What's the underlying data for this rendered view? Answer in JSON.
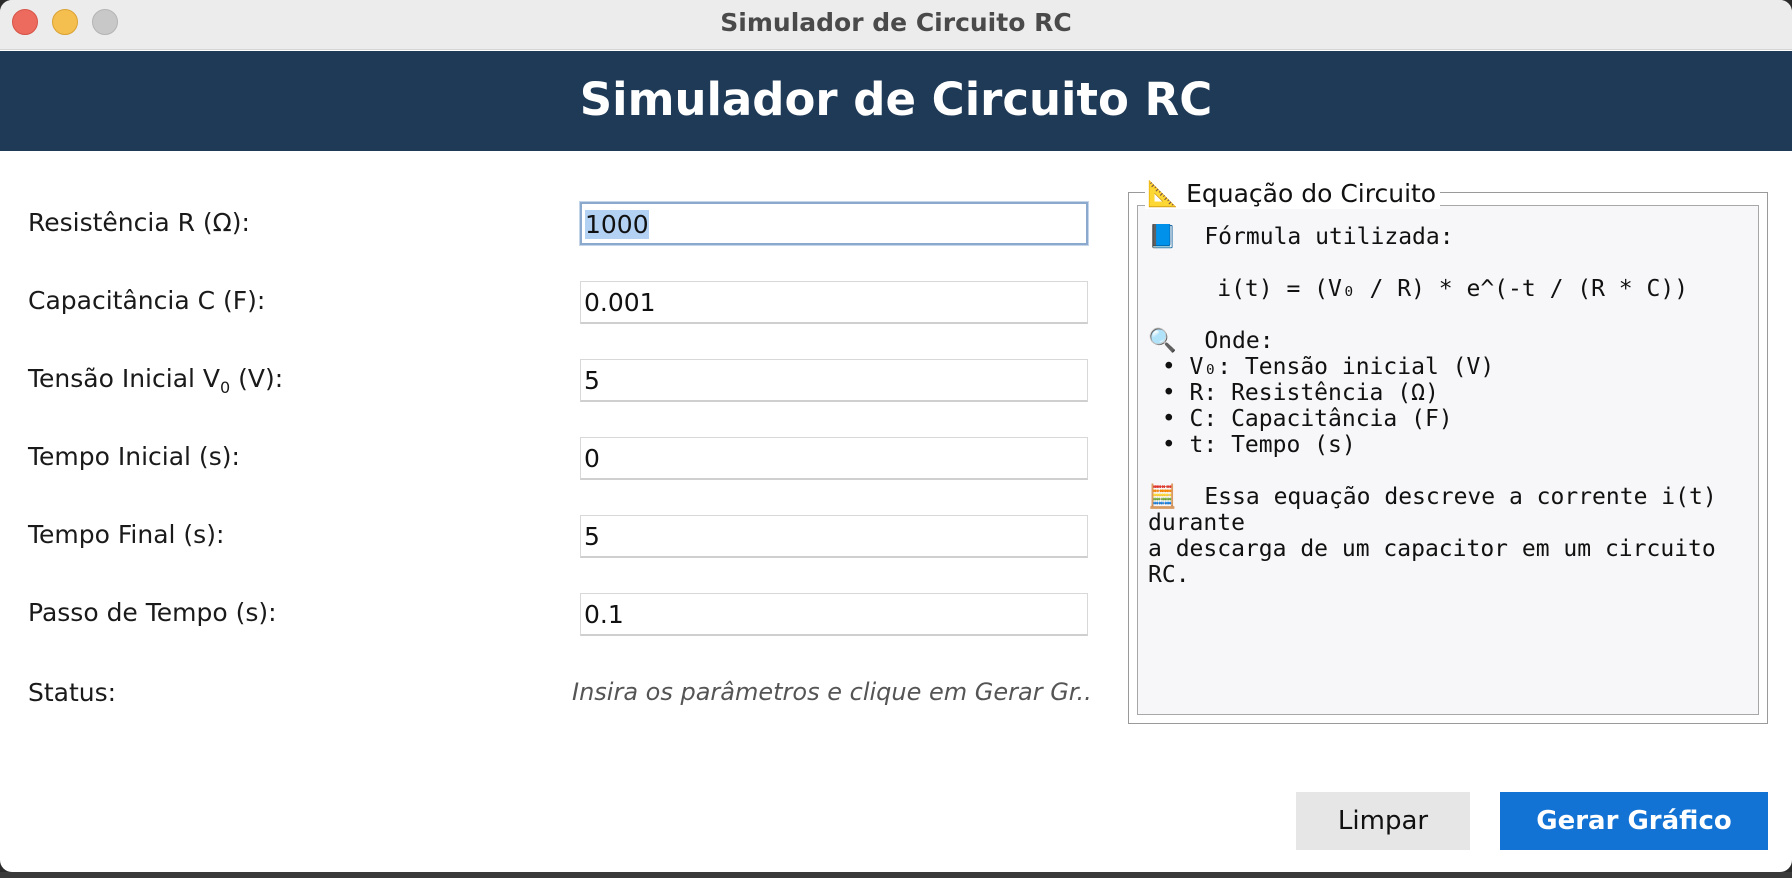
{
  "window": {
    "title": "Simulador de Circuito RC"
  },
  "header": {
    "title": "Simulador de Circuito RC"
  },
  "form": {
    "resistance": {
      "label": "Resistência R (Ω):",
      "value": "1000"
    },
    "capacitance": {
      "label": "Capacitância C (F):",
      "value": "0.001"
    },
    "initial_voltage": {
      "label_prefix": "Tensão Inicial V",
      "label_sub": "0",
      "label_suffix": " (V):",
      "value": "5"
    },
    "initial_time": {
      "label": "Tempo Inicial (s):",
      "value": "0"
    },
    "final_time": {
      "label": "Tempo Final (s):",
      "value": "5"
    },
    "time_step": {
      "label": "Passo de Tempo (s):",
      "value": "0.1"
    },
    "status": {
      "label": "Status:",
      "value": "Insira os parâmetros e clique em Gerar Gr..."
    }
  },
  "equation_panel": {
    "legend_icon": "📐",
    "legend": "Equação do Circuito",
    "lines": [
      "📘  Fórmula utilizada:",
      "",
      "     i(t) = (V₀ / R) * e^(-t / (R * C))",
      "",
      "🔍  Onde:",
      " • V₀: Tensão inicial (V)",
      " • R: Resistência (Ω)",
      " • C: Capacitância (F)",
      " • t: Tempo (s)",
      "",
      "🧮  Essa equação descreve a corrente i(t)",
      "durante",
      "a descarga de um capacitor em um circuito",
      "RC."
    ]
  },
  "buttons": {
    "clear": "Limpar",
    "generate": "Gerar Gráfico"
  }
}
